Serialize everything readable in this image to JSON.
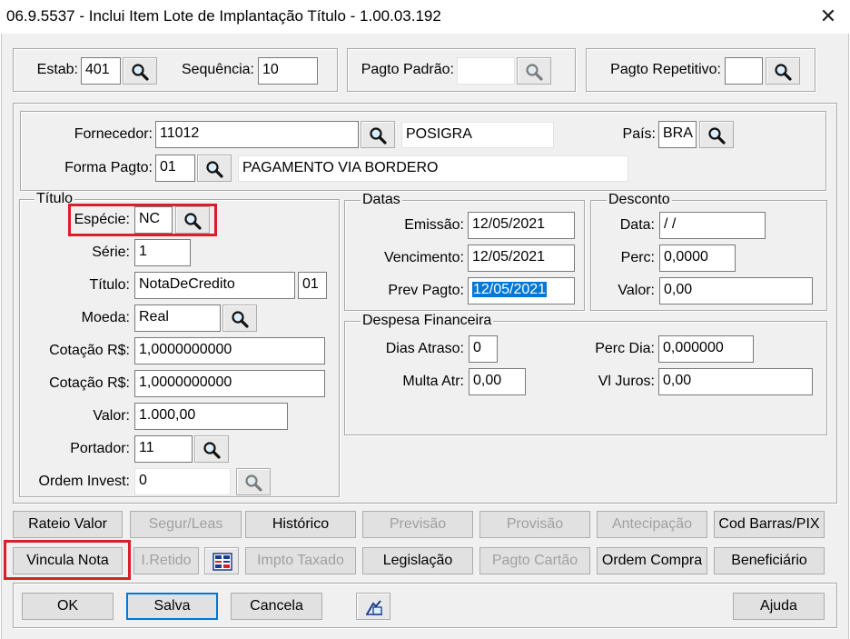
{
  "window": {
    "title": "06.9.5537 - Inclui Item Lote de Implantação Título - 1.00.03.192",
    "close_symbol": "✕"
  },
  "top": {
    "estab_label": "Estab:",
    "estab_value": "401",
    "sequencia_label": "Sequência:",
    "sequencia_value": "10",
    "pagto_padrao_label": "Pagto Padrão:",
    "pagto_padrao_value": "",
    "pagto_repetitivo_label": "Pagto Repetitivo:",
    "pagto_repetitivo_value": ""
  },
  "fornecedor": {
    "label": "Fornecedor:",
    "code": "11012",
    "name": "POSIGRA",
    "pais_label": "País:",
    "pais_value": "BRA",
    "forma_pagto_label": "Forma Pagto:",
    "forma_pagto_code": "01",
    "forma_pagto_desc": "PAGAMENTO VIA BORDERO"
  },
  "titulo": {
    "caption": "Título",
    "especie_label": "Espécie:",
    "especie_value": "NC",
    "serie_label": "Série:",
    "serie_value": "1",
    "titulo_label": "Título:",
    "titulo_value": "NotaDeCredito",
    "parcela_value": "01",
    "moeda_label": "Moeda:",
    "moeda_value": "Real",
    "cotacao1_label": "Cotação R$:",
    "cotacao1_value": "1,0000000000",
    "cotacao2_label": "Cotação R$:",
    "cotacao2_value": "1,0000000000",
    "valor_label": "Valor:",
    "valor_value": "1.000,00",
    "portador_label": "Portador:",
    "portador_value": "11",
    "ordem_invest_label": "Ordem Invest:",
    "ordem_invest_value": "0"
  },
  "datas": {
    "caption": "Datas",
    "emissao_label": "Emissão:",
    "emissao_value": "12/05/2021",
    "vencimento_label": "Vencimento:",
    "vencimento_value": "12/05/2021",
    "prev_pagto_label": "Prev Pagto:",
    "prev_pagto_value": "12/05/2021"
  },
  "desconto": {
    "caption": "Desconto",
    "data_label": "Data:",
    "data_value": " / /",
    "perc_label": "Perc:",
    "perc_value": "0,0000",
    "valor_label": "Valor:",
    "valor_value": "0,00"
  },
  "despesa": {
    "caption": "Despesa Financeira",
    "dias_atraso_label": "Dias Atraso:",
    "dias_atraso_value": "0",
    "perc_dia_label": "Perc Dia:",
    "perc_dia_value": "0,000000",
    "multa_label": "Multa Atr:",
    "multa_value": "0,00",
    "vl_juros_label": "Vl Juros:",
    "vl_juros_value": "0,00"
  },
  "buttons_row1": {
    "rateio_valor": "Rateio Valor",
    "segur_leas": "Segur/Leas",
    "historico": "Histórico",
    "previsao": "Previsão",
    "provisao": "Provisão",
    "antecipacao": "Antecipação",
    "cod_barras": "Cod Barras/PIX"
  },
  "buttons_row2": {
    "vincula_nota": "Vincula Nota",
    "i_retido": "I.Retido",
    "impto_taxado": "Impto Taxado",
    "legislacao": "Legislação",
    "pagto_cartao": "Pagto Cartão",
    "ordem_compra": "Ordem Compra",
    "beneficiario": "Beneficiário"
  },
  "footer": {
    "ok": "OK",
    "salva": "Salva",
    "cancela": "Cancela",
    "ajuda": "Ajuda"
  },
  "icons": {
    "lookup": "magnifier-icon",
    "calc": "table-calc-icon",
    "help": "help-pointer-icon",
    "close": "close-icon"
  },
  "colors": {
    "highlight_red": "#d9202a",
    "selection_blue": "#0078d7",
    "dialog_bg": "#f0f0f0"
  }
}
